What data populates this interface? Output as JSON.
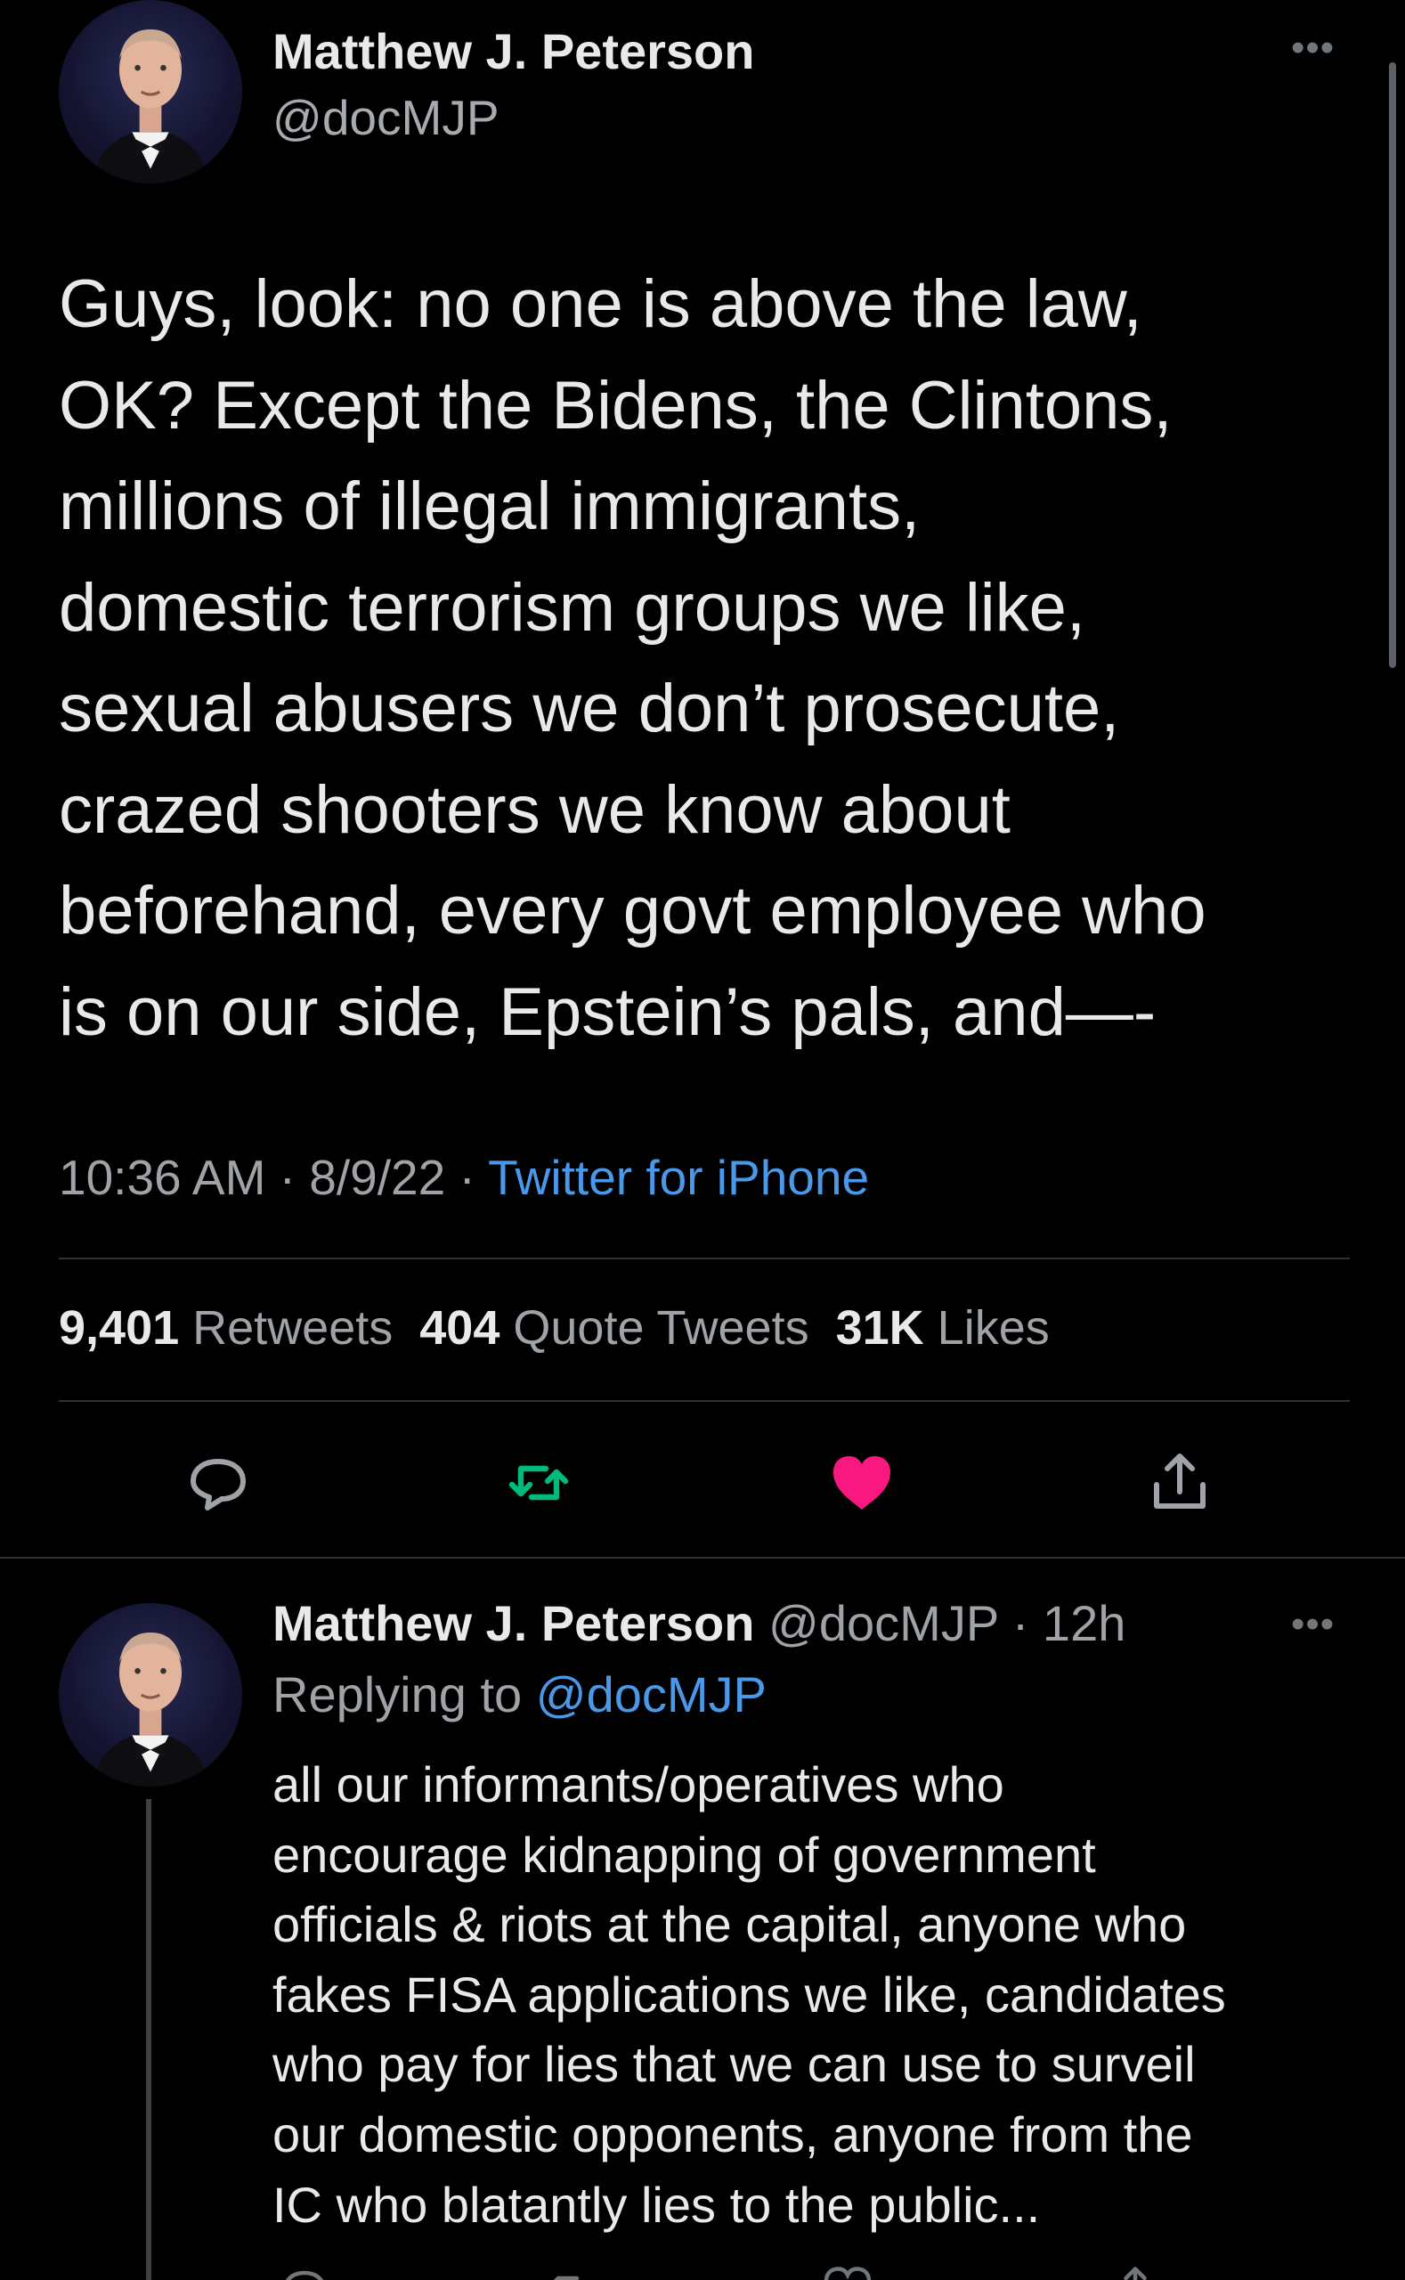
{
  "main_tweet": {
    "author": {
      "name": "Matthew J. Peterson",
      "handle": "@docMJP",
      "avatar_icon": "profile-photo"
    },
    "more_icon": "•••",
    "text": "Guys, look: no one is above the law,\nOK? Except the Bidens, the Clintons,\nmillions of illegal immigrants,\ndomestic terrorism groups we like,\nsexual abusers we don’t prosecute,\ncrazed shooters we know about\nbeforehand, every govt employee who\nis on our side, Epstein’s pals, and—-",
    "time": "10:36 AM",
    "sep1": " · ",
    "date": "8/9/22",
    "sep2": " · ",
    "source": "Twitter for iPhone",
    "stats": {
      "retweets_count": "9,401",
      "retweets_label": "Retweets",
      "quotes_count": "404",
      "quotes_label": "Quote Tweets",
      "likes_count": "31K",
      "likes_label": "Likes"
    },
    "actions": {
      "reply_icon": "reply-icon",
      "retweet_icon": "retweet-icon",
      "like_icon": "heart-icon",
      "share_icon": "share-icon",
      "retweet_color": "#00ba7c",
      "like_color": "#f91880",
      "liked": true
    }
  },
  "reply_tweet": {
    "author": {
      "name": "Matthew J. Peterson",
      "handle": "@docMJP",
      "sep": " · ",
      "time": "12h"
    },
    "more_icon": "•••",
    "replying_prefix": "Replying to ",
    "replying_mention": "@docMJP",
    "text": "all our informants/operatives who\nencourage kidnapping of government\nofficials & riots at the capital, anyone who\nfakes FISA applications we like, candidates\nwho pay for lies that we can use to surveil\nour domestic opponents, anyone from the\nIC who blatantly lies to the public..."
  },
  "colors": {
    "background": "#000000",
    "text": "#e7e9ea",
    "secondary_text": "#9fa3a8",
    "link": "#4a99e9",
    "divider": "#2f3336"
  }
}
